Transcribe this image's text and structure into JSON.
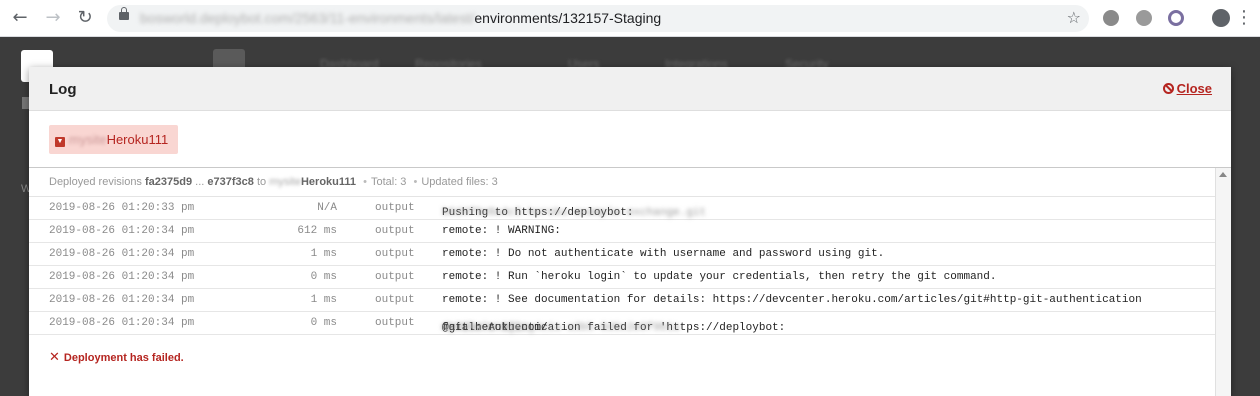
{
  "browser": {
    "url_prefix": "bosworld.deploybot.com/2563/11-environments/latest/",
    "url_path": "environments/132157-Staging"
  },
  "app": {
    "nav": [
      "Dashboard",
      "Repositories",
      "Users",
      "Integrations",
      "Security"
    ],
    "sidebar_letter": "W"
  },
  "modal": {
    "title": "Log",
    "close_label": "Close",
    "server": {
      "prefix": "mysite",
      "name": "Heroku111"
    },
    "summary": {
      "label": "Deployed revisions",
      "from_rev": "fa2375d9",
      "ellipsis": "...",
      "to_rev": "e737f3c8",
      "to_word": "to",
      "target_prefix": "mysite",
      "target": "Heroku111",
      "total": "Total: 3",
      "updated": "Updated files: 3"
    },
    "rows": [
      {
        "time": "2019-08-26 01:20:33 pm",
        "duration": "N/A",
        "type": "output",
        "message": "Pushing to https://deploybot:",
        "hidden": "b6d4f9e8a4c3-heroku-example-exchange.git"
      },
      {
        "time": "2019-08-26 01:20:34 pm",
        "duration": "612 ms",
        "type": "output",
        "message": "remote: ! WARNING:",
        "hidden": ""
      },
      {
        "time": "2019-08-26 01:20:34 pm",
        "duration": "1 ms",
        "type": "output",
        "message": "remote: ! Do not authenticate with username and password using git.",
        "hidden": ""
      },
      {
        "time": "2019-08-26 01:20:34 pm",
        "duration": "0 ms",
        "type": "output",
        "message": "remote: ! Run `heroku login` to update your credentials, then retry the git command.",
        "hidden": ""
      },
      {
        "time": "2019-08-26 01:20:34 pm",
        "duration": "1 ms",
        "type": "output",
        "message": "remote: ! See documentation for details: https://devcenter.heroku.com/articles/git#http-git-authentication",
        "hidden": ""
      },
      {
        "time": "2019-08-26 01:20:34 pm",
        "duration": "0 ms",
        "type": "output",
        "message": "fatal: Authentication failed for 'https://deploybot:",
        "hidden": "4b7d3e2a-9f1c-4e1a-a3b5-8d6c2e0f9b1a",
        "suffix": "@git.heroku.com/",
        "hidden2": "mysite-staging"
      }
    ],
    "status": "Deployment has failed."
  },
  "colors": {
    "accent_red": "#b52520",
    "tag_bg": "#f9d6d2"
  }
}
